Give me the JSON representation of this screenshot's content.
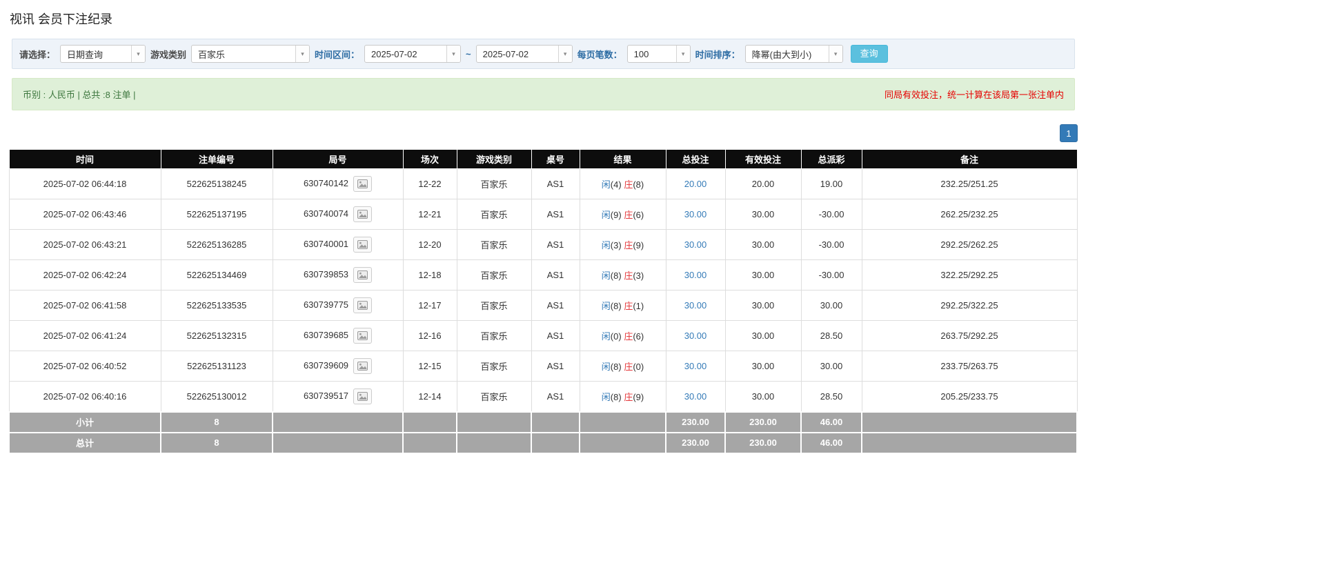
{
  "page": {
    "title": "视讯 会员下注纪录"
  },
  "filters": {
    "select_label": "请选择：",
    "select_value": "日期查询",
    "game_type_label": "游戏类别",
    "game_type_value": "百家乐",
    "date_range_label": "时间区间：",
    "date_from": "2025-07-02",
    "tilde": "~",
    "date_to": "2025-07-02",
    "page_size_label": "每页笔数：",
    "page_size_value": "100",
    "sort_label": "时间排序：",
    "sort_value": "降幂(由大到小)",
    "search_button": "查询"
  },
  "summary": {
    "left": "币别 : 人民币 | 总共 :8 注单 |",
    "right": "同局有效投注，统一计算在该局第一张注单内"
  },
  "pagination": {
    "current": "1"
  },
  "table": {
    "headers": [
      "时间",
      "注单编号",
      "局号",
      "场次",
      "游戏类别",
      "桌号",
      "结果",
      "总投注",
      "有效投注",
      "总派彩",
      "备注"
    ],
    "rows": [
      {
        "time": "2025-07-02 06:44:18",
        "bet_id": "522625138245",
        "round": "630740142",
        "session": "12-22",
        "game": "百家乐",
        "table_no": "AS1",
        "player_name": "闲",
        "player_score": "(4)",
        "banker_name": "庄",
        "banker_score": "(8)",
        "total_bet": "20.00",
        "valid_bet": "20.00",
        "payout": "19.00",
        "note": "232.25/251.25"
      },
      {
        "time": "2025-07-02 06:43:46",
        "bet_id": "522625137195",
        "round": "630740074",
        "session": "12-21",
        "game": "百家乐",
        "table_no": "AS1",
        "player_name": "闲",
        "player_score": "(9)",
        "banker_name": "庄",
        "banker_score": "(6)",
        "total_bet": "30.00",
        "valid_bet": "30.00",
        "payout": "-30.00",
        "note": "262.25/232.25"
      },
      {
        "time": "2025-07-02 06:43:21",
        "bet_id": "522625136285",
        "round": "630740001",
        "session": "12-20",
        "game": "百家乐",
        "table_no": "AS1",
        "player_name": "闲",
        "player_score": "(3)",
        "banker_name": "庄",
        "banker_score": "(9)",
        "total_bet": "30.00",
        "valid_bet": "30.00",
        "payout": "-30.00",
        "note": "292.25/262.25"
      },
      {
        "time": "2025-07-02 06:42:24",
        "bet_id": "522625134469",
        "round": "630739853",
        "session": "12-18",
        "game": "百家乐",
        "table_no": "AS1",
        "player_name": "闲",
        "player_score": "(8)",
        "banker_name": "庄",
        "banker_score": "(3)",
        "total_bet": "30.00",
        "valid_bet": "30.00",
        "payout": "-30.00",
        "note": "322.25/292.25"
      },
      {
        "time": "2025-07-02 06:41:58",
        "bet_id": "522625133535",
        "round": "630739775",
        "session": "12-17",
        "game": "百家乐",
        "table_no": "AS1",
        "player_name": "闲",
        "player_score": "(8)",
        "banker_name": "庄",
        "banker_score": "(1)",
        "total_bet": "30.00",
        "valid_bet": "30.00",
        "payout": "30.00",
        "note": "292.25/322.25"
      },
      {
        "time": "2025-07-02 06:41:24",
        "bet_id": "522625132315",
        "round": "630739685",
        "session": "12-16",
        "game": "百家乐",
        "table_no": "AS1",
        "player_name": "闲",
        "player_score": "(0)",
        "banker_name": "庄",
        "banker_score": "(6)",
        "total_bet": "30.00",
        "valid_bet": "30.00",
        "payout": "28.50",
        "note": "263.75/292.25"
      },
      {
        "time": "2025-07-02 06:40:52",
        "bet_id": "522625131123",
        "round": "630739609",
        "session": "12-15",
        "game": "百家乐",
        "table_no": "AS1",
        "player_name": "闲",
        "player_score": "(8)",
        "banker_name": "庄",
        "banker_score": "(0)",
        "total_bet": "30.00",
        "valid_bet": "30.00",
        "payout": "30.00",
        "note": "233.75/263.75"
      },
      {
        "time": "2025-07-02 06:40:16",
        "bet_id": "522625130012",
        "round": "630739517",
        "session": "12-14",
        "game": "百家乐",
        "table_no": "AS1",
        "player_name": "闲",
        "player_score": "(8)",
        "banker_name": "庄",
        "banker_score": "(9)",
        "total_bet": "30.00",
        "valid_bet": "30.00",
        "payout": "28.50",
        "note": "205.25/233.75"
      }
    ],
    "subtotal": {
      "label": "小计",
      "count": "8",
      "total_bet": "230.00",
      "valid_bet": "230.00",
      "payout": "46.00"
    },
    "total": {
      "label": "总计",
      "count": "8",
      "total_bet": "230.00",
      "valid_bet": "230.00",
      "payout": "46.00"
    }
  }
}
